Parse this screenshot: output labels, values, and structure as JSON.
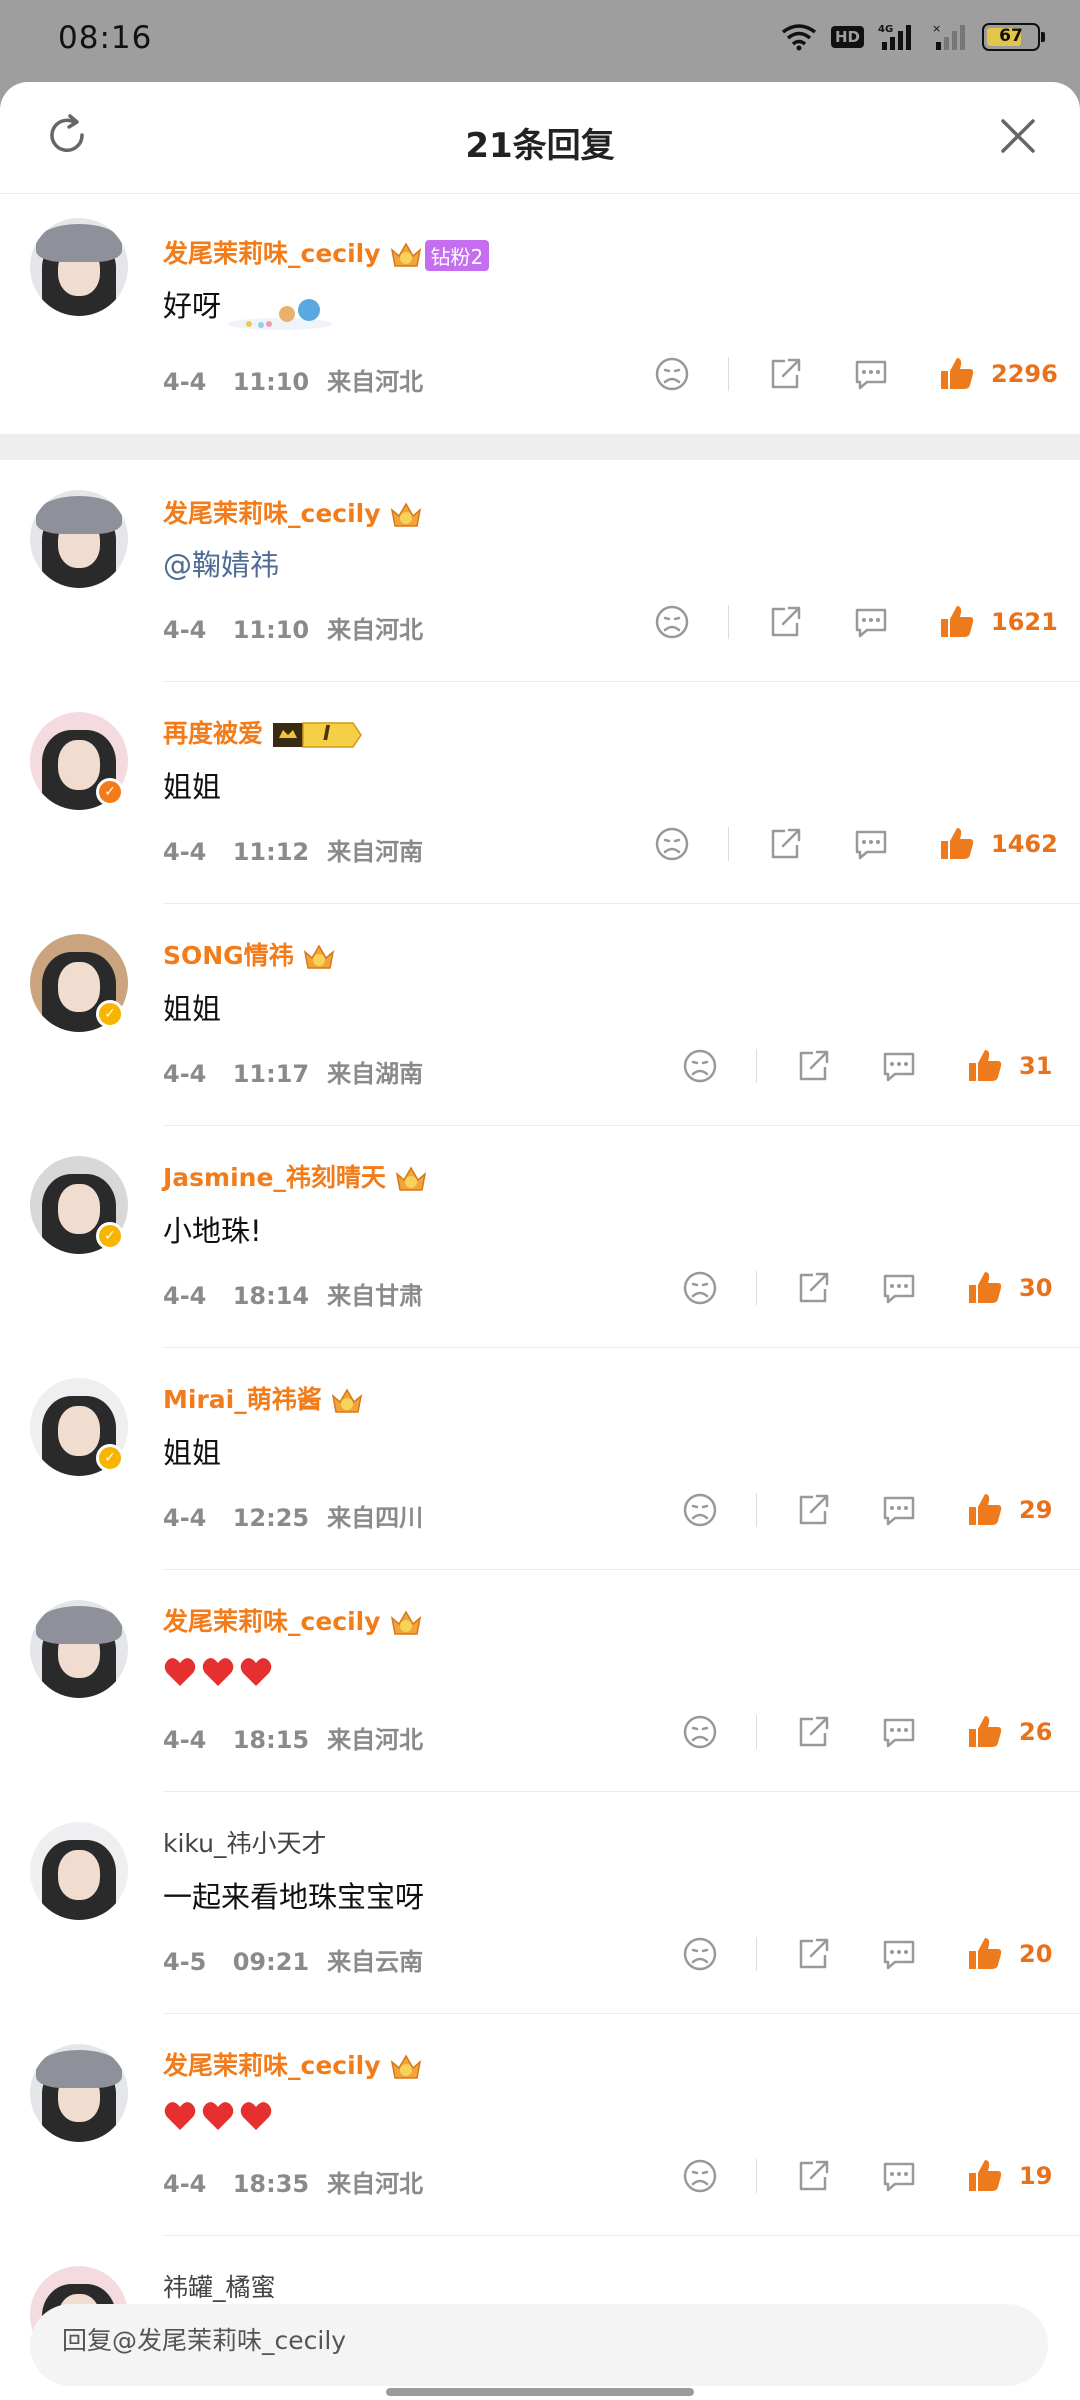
{
  "status_bar": {
    "time": "08:16",
    "network_hd": "HD",
    "network_4g": "4G",
    "battery": "67",
    "battery_level": 0.67
  },
  "header": {
    "title": "21条回复",
    "refresh_icon": "refresh-icon",
    "close_icon": "close-icon"
  },
  "top_comment": {
    "user": "发尾茉莉味_cecily",
    "fan_badge": "钻粉2",
    "text": "好呀",
    "date": "4-4",
    "time": "11:10",
    "location": "来自河北",
    "likes": "2296"
  },
  "replies": [
    {
      "user": "发尾茉莉味_cecily",
      "text": "@鞠婧祎",
      "date": "4-4",
      "time": "11:10",
      "location": "来自河北",
      "likes": "1621"
    },
    {
      "user": "再度被爱",
      "rank": "I",
      "text": "姐姐",
      "date": "4-4",
      "time": "11:12",
      "location": "来自河南",
      "likes": "1462"
    },
    {
      "user": "SONG情祎",
      "text": "姐姐",
      "date": "4-4",
      "time": "11:17",
      "location": "来自湖南",
      "likes": "31"
    },
    {
      "user": "Jasmine_祎刻晴天",
      "text": "小地珠!",
      "date": "4-4",
      "time": "18:14",
      "location": "来自甘肃",
      "likes": "30"
    },
    {
      "user": "Mirai_萌祎酱",
      "text": "姐姐",
      "date": "4-4",
      "time": "12:25",
      "location": "来自四川",
      "likes": "29"
    },
    {
      "user": "发尾茉莉味_cecily",
      "text": "",
      "date": "4-4",
      "time": "18:15",
      "location": "来自河北",
      "likes": "26"
    },
    {
      "user": "kiku_祎小天才",
      "text": "一起来看地珠宝宝呀",
      "date": "4-5",
      "time": "09:21",
      "location": "来自云南",
      "likes": "20"
    },
    {
      "user": "发尾茉莉味_cecily",
      "text": "",
      "date": "4-4",
      "time": "18:35",
      "location": "来自河北",
      "likes": "19"
    },
    {
      "user": "祎罐_橘蜜",
      "text": "",
      "date": "",
      "time": "",
      "location": "",
      "likes": ""
    }
  ],
  "reply_bar": {
    "placeholder": "回复@发尾茉莉味_cecily"
  },
  "colors": {
    "accent": "#f27b1a",
    "mention": "#4f6c95",
    "fan_badge": "#c56ef0",
    "heart": "#e5302f",
    "verified": "#f7b500"
  },
  "icons": [
    "dislike-icon",
    "share-icon",
    "comment-icon",
    "like-icon",
    "crown-icon",
    "heart-icon",
    "verified-icon"
  ]
}
